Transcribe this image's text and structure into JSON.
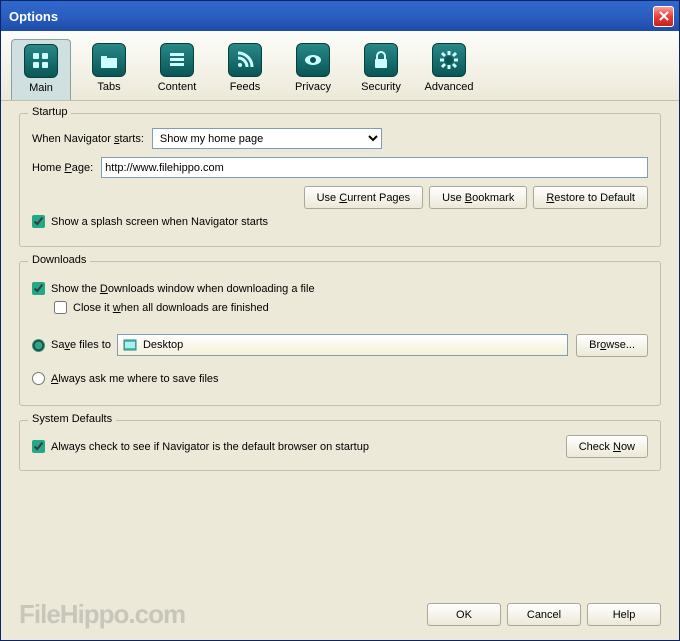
{
  "window": {
    "title": "Options"
  },
  "tabs": [
    {
      "label": "Main"
    },
    {
      "label": "Tabs"
    },
    {
      "label": "Content"
    },
    {
      "label": "Feeds"
    },
    {
      "label": "Privacy"
    },
    {
      "label": "Security"
    },
    {
      "label": "Advanced"
    }
  ],
  "startup": {
    "title": "Startup",
    "when_label_pre": "When Navigator ",
    "when_label_u": "s",
    "when_label_post": "tarts:",
    "when_value": "Show my home page",
    "home_label": "Home ",
    "home_label_u": "P",
    "home_label_post": "age:",
    "home_value": "http://www.filehippo.com",
    "use_current_pre": "Use ",
    "use_current_u": "C",
    "use_current_post": "urrent Pages",
    "use_bookmark_pre": "Use ",
    "use_bookmark_u": "B",
    "use_bookmark_post": "ookmark",
    "restore_u": "R",
    "restore_post": "estore to Default",
    "splash": "Show a splash screen when Navigator starts"
  },
  "downloads": {
    "title": "Downloads",
    "show_pre": "Show the ",
    "show_u": "D",
    "show_post": "ownloads window when downloading a file",
    "close_pre": "Close it ",
    "close_u": "w",
    "close_post": "hen all downloads are finished",
    "save_to_pre": "Sa",
    "save_to_u": "v",
    "save_to_post": "e files to",
    "location": "Desktop",
    "browse_pre": "Br",
    "browse_u": "o",
    "browse_post": "wse...",
    "always_u": "A",
    "always_post": "lways ask me where to save files"
  },
  "system": {
    "title": "System Defaults",
    "check": "Always check to see if Navigator is the default browser on startup",
    "check_now_pre": "Check ",
    "check_now_u": "N",
    "check_now_post": "ow"
  },
  "buttons": {
    "ok": "OK",
    "cancel": "Cancel",
    "help": "Help"
  },
  "watermark": "FileHippo.com"
}
